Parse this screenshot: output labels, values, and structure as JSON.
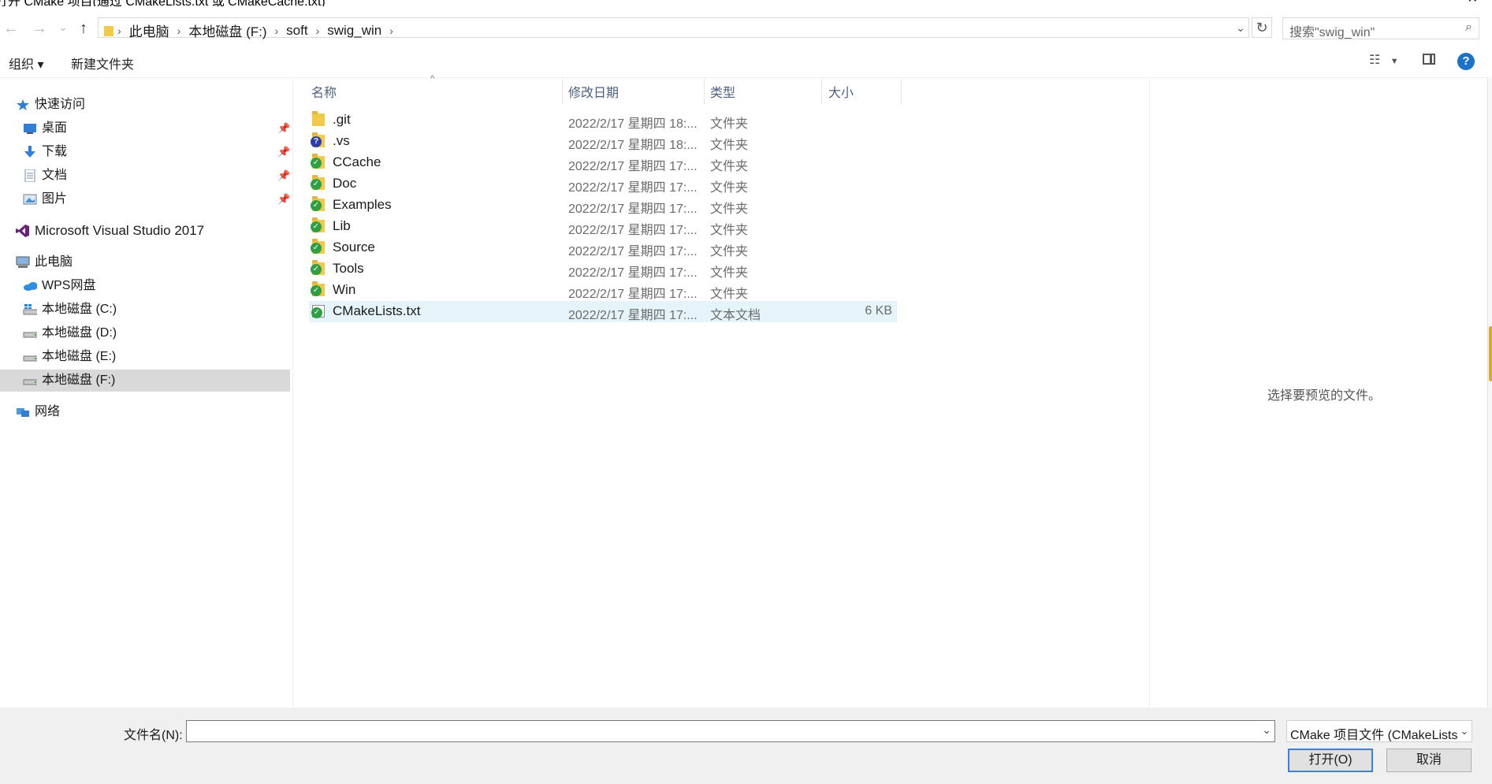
{
  "window": {
    "title": "打开 CMake 项目(通过 CMakeLists.txt 或 CMakeCache.txt)"
  },
  "nav": {
    "back": "←",
    "forward": "→",
    "recent": "⌄",
    "up": "↑"
  },
  "breadcrumbs": [
    "此电脑",
    "本地磁盘 (F:)",
    "soft",
    "swig_win"
  ],
  "search": {
    "placeholder": "搜索\"swig_win\""
  },
  "toolbar": {
    "organize": "组织 ▾",
    "new_folder": "新建文件夹",
    "help": "?"
  },
  "sidebar": {
    "quick_access": "快速访问",
    "pinned": [
      {
        "label": "桌面",
        "icon": "desktop-icon"
      },
      {
        "label": "下载",
        "icon": "download-icon"
      },
      {
        "label": "文档",
        "icon": "documents-icon"
      },
      {
        "label": "图片",
        "icon": "pictures-icon"
      }
    ],
    "vs": "Microsoft Visual Studio 2017",
    "this_pc": "此电脑",
    "drives": [
      {
        "label": "WPS网盘",
        "icon": "cloud-icon"
      },
      {
        "label": "本地磁盘 (C:)",
        "icon": "drive-windows-icon"
      },
      {
        "label": "本地磁盘 (D:)",
        "icon": "drive-icon"
      },
      {
        "label": "本地磁盘 (E:)",
        "icon": "drive-icon"
      },
      {
        "label": "本地磁盘 (F:)",
        "icon": "drive-icon",
        "selected": true
      }
    ],
    "network": "网络"
  },
  "columns": {
    "name": "名称",
    "modified": "修改日期",
    "type": "类型",
    "size": "大小"
  },
  "files": [
    {
      "name": ".git",
      "modified": "2022/2/17 星期四 18:...",
      "type": "文件夹",
      "size": "",
      "badge": "none"
    },
    {
      "name": ".vs",
      "modified": "2022/2/17 星期四 18:...",
      "type": "文件夹",
      "size": "",
      "badge": "question"
    },
    {
      "name": "CCache",
      "modified": "2022/2/17 星期四 17:...",
      "type": "文件夹",
      "size": "",
      "badge": "ok"
    },
    {
      "name": "Doc",
      "modified": "2022/2/17 星期四 17:...",
      "type": "文件夹",
      "size": "",
      "badge": "ok"
    },
    {
      "name": "Examples",
      "modified": "2022/2/17 星期四 17:...",
      "type": "文件夹",
      "size": "",
      "badge": "ok"
    },
    {
      "name": "Lib",
      "modified": "2022/2/17 星期四 17:...",
      "type": "文件夹",
      "size": "",
      "badge": "ok"
    },
    {
      "name": "Source",
      "modified": "2022/2/17 星期四 17:...",
      "type": "文件夹",
      "size": "",
      "badge": "ok"
    },
    {
      "name": "Tools",
      "modified": "2022/2/17 星期四 17:...",
      "type": "文件夹",
      "size": "",
      "badge": "ok"
    },
    {
      "name": "Win",
      "modified": "2022/2/17 星期四 17:...",
      "type": "文件夹",
      "size": "",
      "badge": "ok"
    },
    {
      "name": "CMakeLists.txt",
      "modified": "2022/2/17 星期四 17:...",
      "type": "文本文档",
      "size": "6 KB",
      "badge": "ok-file",
      "selected": true
    }
  ],
  "preview": {
    "empty_text": "选择要预览的文件。"
  },
  "footer": {
    "filename_label": "文件名(N):",
    "filename_value": "",
    "filter": "CMake 项目文件 (CMakeLists.txt;CMakeCache.txt)",
    "open": "打开(O)",
    "cancel": "取消"
  }
}
